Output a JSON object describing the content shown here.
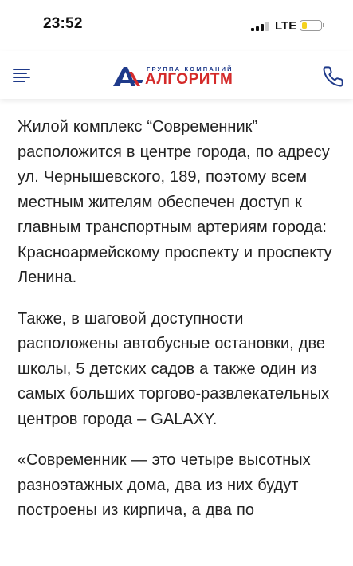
{
  "status_bar": {
    "time": "23:52",
    "network": "LTE",
    "battery_level": 0.25,
    "battery_color": "#f4d21e"
  },
  "header": {
    "menu_icon": "hamburger-menu-icon",
    "logo": {
      "subtitle": "ГРУППА КОМПАНИЙ",
      "name": "АЛГОРИТМ",
      "primary_color": "#1f3a8a",
      "accent_color": "#d42a2a"
    },
    "phone_icon": "phone-icon"
  },
  "article": {
    "paragraphs": [
      "Жилой комплекс “Современник” расположится в центре города, по адресу ул. Чернышевского, 189, поэтому всем местным жителям обеспечен доступ к главным транспортным артериям города: Красноармейскому проспекту и проспекту Ленина.",
      "Также, в шаговой доступности расположены автобусные остановки, две школы, 5 детских садов а также один из самых больших торгово-развлекательных центров города – GALAXY.",
      "«Современник — это четыре высотных разноэтажных дома, два из них будут построены из кирпича, а два по"
    ]
  }
}
